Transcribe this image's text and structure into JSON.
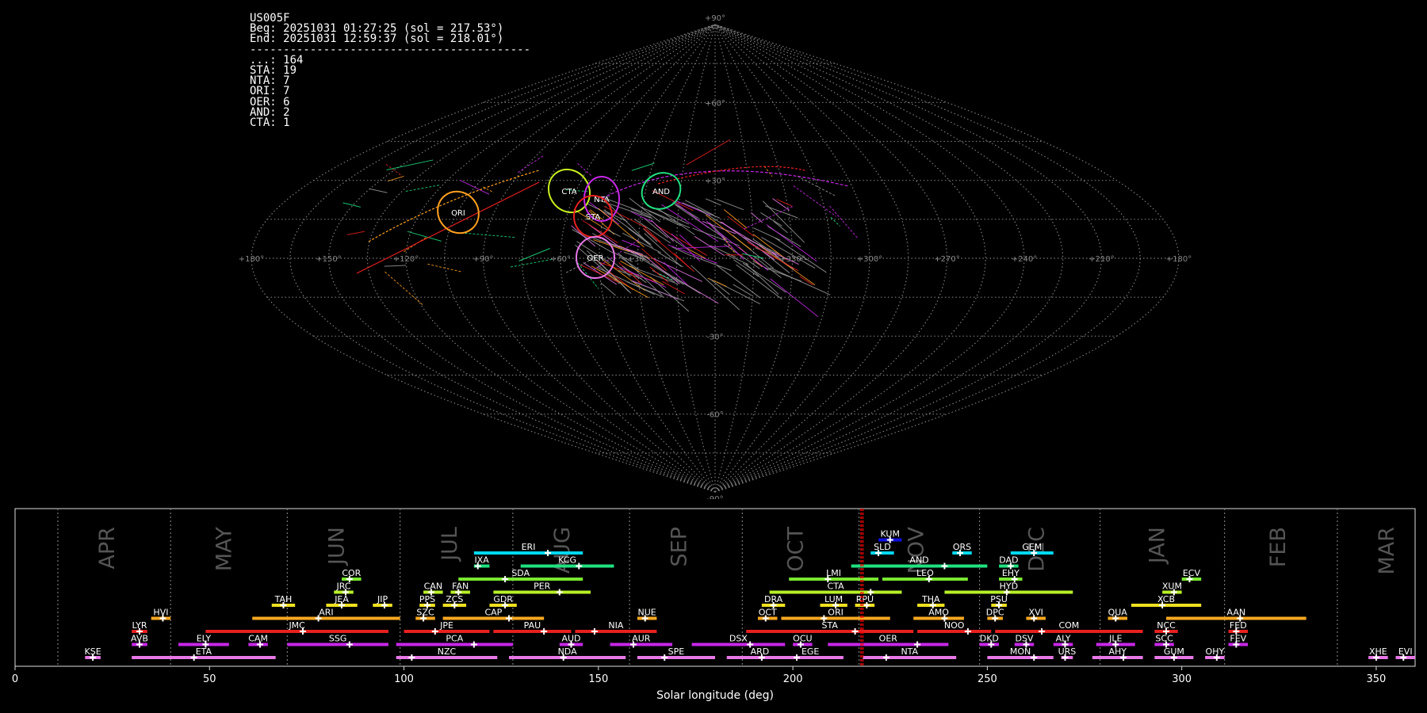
{
  "info": {
    "lines": [
      "US005F",
      "Beg: 20251031 01:27:25 (sol = 217.53°)",
      "End: 20251031 12:59:37 (sol = 218.01°)",
      "------------------------------------------",
      "...: 164",
      "STA: 19",
      "NTA: 7",
      "ORI: 7",
      "OER: 6",
      "AND: 2",
      "CTA: 1"
    ]
  },
  "sky_map": {
    "projection": "sinusoidal",
    "lat_labels": [
      "+90°",
      "+60°",
      "+30°",
      "-30°",
      "-60°",
      "-90°"
    ],
    "lon_labels": [
      "+180°",
      "+150°",
      "+120°",
      "+90°",
      "+60°",
      "+30°",
      "+330°",
      "+300°",
      "+270°",
      "+240°",
      "+210°",
      "+180°"
    ],
    "radiants": [
      {
        "name": "CTA",
        "color": "#c8f020"
      },
      {
        "name": "NTA",
        "color": "#c828e8"
      },
      {
        "name": "AND",
        "color": "#20e080"
      },
      {
        "name": "ORI",
        "color": "#ffa020"
      },
      {
        "name": "STA",
        "color": "#e82020"
      },
      {
        "name": "OER",
        "color": "#e878e8"
      }
    ]
  },
  "chart_data": {
    "type": "bar",
    "xlabel": "Solar longitude (deg)",
    "xlim": [
      0,
      360
    ],
    "xticks": [
      "0",
      "50",
      "100",
      "150",
      "200",
      "250",
      "300",
      "350"
    ],
    "months": [
      {
        "label": "APR",
        "center": 24
      },
      {
        "label": "MAY",
        "center": 54
      },
      {
        "label": "JUN",
        "center": 83
      },
      {
        "label": "JUL",
        "center": 112
      },
      {
        "label": "AUG",
        "center": 141
      },
      {
        "label": "SEP",
        "center": 171
      },
      {
        "label": "OCT",
        "center": 201
      },
      {
        "label": "NOV",
        "center": 232
      },
      {
        "label": "DEC",
        "center": 263
      },
      {
        "label": "JAN",
        "center": 294
      },
      {
        "label": "FEB",
        "center": 325
      },
      {
        "label": "MAR",
        "center": 353
      }
    ],
    "month_boundaries": [
      11,
      40,
      70,
      99,
      128,
      158,
      187,
      217,
      248,
      279,
      311,
      340
    ],
    "current_sol": [
      217.53,
      218.01
    ],
    "current_color": "#ff0000",
    "showers": [
      {
        "code": "KUM",
        "start": 222,
        "end": 228,
        "peak": 225,
        "row": 9,
        "color": "#1010e0"
      },
      {
        "code": "ERI",
        "start": 118,
        "end": 146,
        "peak": 137,
        "row": 8,
        "color": "#00d8f0"
      },
      {
        "code": "SLD",
        "start": 220,
        "end": 226,
        "peak": 222,
        "row": 8,
        "color": "#00d8f0"
      },
      {
        "code": "ORS",
        "start": 241,
        "end": 246,
        "peak": 243,
        "row": 8,
        "color": "#00d8f0"
      },
      {
        "code": "GEM",
        "start": 256,
        "end": 267,
        "peak": 262,
        "row": 8,
        "color": "#00d8f0"
      },
      {
        "code": "IXA",
        "start": 118,
        "end": 122,
        "peak": 119,
        "row": 7,
        "color": "#20e080"
      },
      {
        "code": "KCG",
        "start": 130,
        "end": 154,
        "peak": 145,
        "row": 7,
        "color": "#20e080"
      },
      {
        "code": "AND",
        "start": 215,
        "end": 250,
        "peak": 239,
        "row": 7,
        "color": "#20e080"
      },
      {
        "code": "DAD",
        "start": 253,
        "end": 258,
        "peak": 256,
        "row": 7,
        "color": "#20e080"
      },
      {
        "code": "COR",
        "start": 84,
        "end": 89,
        "peak": 86,
        "row": 6,
        "color": "#78e830"
      },
      {
        "code": "SDA",
        "start": 114,
        "end": 146,
        "peak": 126,
        "row": 6,
        "color": "#78e830"
      },
      {
        "code": "LMI",
        "start": 199,
        "end": 222,
        "peak": 209,
        "row": 6,
        "color": "#78e830"
      },
      {
        "code": "LEO",
        "start": 223,
        "end": 245,
        "peak": 235,
        "row": 6,
        "color": "#78e830"
      },
      {
        "code": "EHY",
        "start": 253,
        "end": 259,
        "peak": 257,
        "row": 6,
        "color": "#78e830"
      },
      {
        "code": "ECV",
        "start": 300,
        "end": 305,
        "peak": 302,
        "row": 6,
        "color": "#78e830"
      },
      {
        "code": "JRC",
        "start": 82,
        "end": 87,
        "peak": 85,
        "row": 5,
        "color": "#b8f028"
      },
      {
        "code": "CAN",
        "start": 105,
        "end": 110,
        "peak": 107,
        "row": 5,
        "color": "#b8f028"
      },
      {
        "code": "FAN",
        "start": 112,
        "end": 117,
        "peak": 114,
        "row": 5,
        "color": "#b8f028"
      },
      {
        "code": "PER",
        "start": 123,
        "end": 148,
        "peak": 140,
        "row": 5,
        "color": "#b8f028"
      },
      {
        "code": "CTA",
        "start": 194,
        "end": 228,
        "peak": 220,
        "row": 5,
        "color": "#b8f028"
      },
      {
        "code": "HYD",
        "start": 239,
        "end": 272,
        "peak": 255,
        "row": 5,
        "color": "#b8f028"
      },
      {
        "code": "XUM",
        "start": 295,
        "end": 300,
        "peak": 298,
        "row": 5,
        "color": "#b8f028"
      },
      {
        "code": "TAH",
        "start": 66,
        "end": 72,
        "peak": 69,
        "row": 4,
        "color": "#f0e020"
      },
      {
        "code": "JEA",
        "start": 80,
        "end": 88,
        "peak": 84,
        "row": 4,
        "color": "#f0e020"
      },
      {
        "code": "JIP",
        "start": 92,
        "end": 97,
        "peak": 95,
        "row": 4,
        "color": "#f0e020"
      },
      {
        "code": "PPS",
        "start": 104,
        "end": 108,
        "peak": 106,
        "row": 4,
        "color": "#f0e020"
      },
      {
        "code": "ZCS",
        "start": 110,
        "end": 116,
        "peak": 113,
        "row": 4,
        "color": "#f0e020"
      },
      {
        "code": "GDR",
        "start": 122,
        "end": 129,
        "peak": 126,
        "row": 4,
        "color": "#f0e020"
      },
      {
        "code": "DRA",
        "start": 192,
        "end": 198,
        "peak": 195,
        "row": 4,
        "color": "#f0e020"
      },
      {
        "code": "LUM",
        "start": 207,
        "end": 214,
        "peak": 211,
        "row": 4,
        "color": "#f0e020"
      },
      {
        "code": "RPU",
        "start": 216,
        "end": 221,
        "peak": 219,
        "row": 4,
        "color": "#f0e020"
      },
      {
        "code": "THA",
        "start": 232,
        "end": 239,
        "peak": 236,
        "row": 4,
        "color": "#f0e020"
      },
      {
        "code": "PSU",
        "start": 251,
        "end": 255,
        "peak": 253,
        "row": 4,
        "color": "#f0e020"
      },
      {
        "code": "XCB",
        "start": 287,
        "end": 305,
        "peak": 295,
        "row": 4,
        "color": "#f0e020"
      },
      {
        "code": "HVI",
        "start": 35,
        "end": 40,
        "peak": 38,
        "row": 3,
        "color": "#f8a820"
      },
      {
        "code": "ARI",
        "start": 61,
        "end": 99,
        "peak": 78,
        "row": 3,
        "color": "#f8a820"
      },
      {
        "code": "SZC",
        "start": 103,
        "end": 108,
        "peak": 105,
        "row": 3,
        "color": "#f8a820"
      },
      {
        "code": "CAP",
        "start": 110,
        "end": 136,
        "peak": 127,
        "row": 3,
        "color": "#f8a820"
      },
      {
        "code": "NUE",
        "start": 160,
        "end": 165,
        "peak": 162,
        "row": 3,
        "color": "#f8a820"
      },
      {
        "code": "OCT",
        "start": 191,
        "end": 196,
        "peak": 193,
        "row": 3,
        "color": "#f8a820"
      },
      {
        "code": "ORI",
        "start": 197,
        "end": 225,
        "peak": 208,
        "row": 3,
        "color": "#f8a820"
      },
      {
        "code": "AMO",
        "start": 231,
        "end": 244,
        "peak": 239,
        "row": 3,
        "color": "#f8a820"
      },
      {
        "code": "DPC",
        "start": 250,
        "end": 254,
        "peak": 252,
        "row": 3,
        "color": "#f8a820"
      },
      {
        "code": "XVI",
        "start": 260,
        "end": 265,
        "peak": 262,
        "row": 3,
        "color": "#f8a820"
      },
      {
        "code": "QUA",
        "start": 281,
        "end": 286,
        "peak": 283,
        "row": 3,
        "color": "#f8a820"
      },
      {
        "code": "AAN",
        "start": 296,
        "end": 332,
        "peak": 315,
        "row": 3,
        "color": "#f8a820"
      },
      {
        "code": "LYR",
        "start": 30,
        "end": 34,
        "peak": 32,
        "row": 2,
        "color": "#e82020"
      },
      {
        "code": "JMC",
        "start": 49,
        "end": 96,
        "peak": 74,
        "row": 2,
        "color": "#e82020"
      },
      {
        "code": "JPE",
        "start": 100,
        "end": 122,
        "peak": 108,
        "row": 2,
        "color": "#e82020"
      },
      {
        "code": "PAU",
        "start": 123,
        "end": 143,
        "peak": 136,
        "row": 2,
        "color": "#e82020"
      },
      {
        "code": "NIA",
        "start": 144,
        "end": 165,
        "peak": 149,
        "row": 2,
        "color": "#e82020"
      },
      {
        "code": "STA",
        "start": 188,
        "end": 231,
        "peak": 216,
        "row": 2,
        "color": "#e82020"
      },
      {
        "code": "NOO",
        "start": 232,
        "end": 251,
        "peak": 245,
        "row": 2,
        "color": "#e82020"
      },
      {
        "code": "COM",
        "start": 252,
        "end": 290,
        "peak": 264,
        "row": 2,
        "color": "#e82020"
      },
      {
        "code": "NCC",
        "start": 293,
        "end": 299,
        "peak": 296,
        "row": 2,
        "color": "#e82020"
      },
      {
        "code": "FED",
        "start": 312,
        "end": 317,
        "peak": 314,
        "row": 2,
        "color": "#e82020"
      },
      {
        "code": "AVB",
        "start": 30,
        "end": 34,
        "peak": 32,
        "row": 1,
        "color": "#c828e8"
      },
      {
        "code": "ELY",
        "start": 42,
        "end": 55,
        "peak": 49,
        "row": 1,
        "color": "#c828e8"
      },
      {
        "code": "CAM",
        "start": 60,
        "end": 65,
        "peak": 63,
        "row": 1,
        "color": "#c828e8"
      },
      {
        "code": "SSG",
        "start": 70,
        "end": 96,
        "peak": 86,
        "row": 1,
        "color": "#c828e8"
      },
      {
        "code": "PCA",
        "start": 98,
        "end": 128,
        "peak": 118,
        "row": 1,
        "color": "#c828e8"
      },
      {
        "code": "AUD",
        "start": 140,
        "end": 146,
        "peak": 143,
        "row": 1,
        "color": "#c828e8"
      },
      {
        "code": "AUR",
        "start": 153,
        "end": 169,
        "peak": 159,
        "row": 1,
        "color": "#c828e8"
      },
      {
        "code": "DSX",
        "start": 174,
        "end": 198,
        "peak": 189,
        "row": 1,
        "color": "#c828e8"
      },
      {
        "code": "OCU",
        "start": 200,
        "end": 205,
        "peak": 202,
        "row": 1,
        "color": "#c828e8"
      },
      {
        "code": "OER",
        "start": 209,
        "end": 240,
        "peak": 232,
        "row": 1,
        "color": "#c828e8"
      },
      {
        "code": "DKD",
        "start": 248,
        "end": 253,
        "peak": 251,
        "row": 1,
        "color": "#c828e8"
      },
      {
        "code": "DSV",
        "start": 257,
        "end": 262,
        "peak": 260,
        "row": 1,
        "color": "#c828e8"
      },
      {
        "code": "ALY",
        "start": 267,
        "end": 272,
        "peak": 270,
        "row": 1,
        "color": "#c828e8"
      },
      {
        "code": "JLE",
        "start": 278,
        "end": 288,
        "peak": 283,
        "row": 1,
        "color": "#c828e8"
      },
      {
        "code": "SCC",
        "start": 293,
        "end": 298,
        "peak": 296,
        "row": 1,
        "color": "#c828e8"
      },
      {
        "code": "FEV",
        "start": 312,
        "end": 317,
        "peak": 314,
        "row": 1,
        "color": "#c828e8"
      },
      {
        "code": "KSE",
        "start": 18,
        "end": 22,
        "peak": 20,
        "row": 0,
        "color": "#e878e8"
      },
      {
        "code": "ETA",
        "start": 30,
        "end": 67,
        "peak": 46,
        "row": 0,
        "color": "#e878e8"
      },
      {
        "code": "NZC",
        "start": 98,
        "end": 124,
        "peak": 102,
        "row": 0,
        "color": "#e878e8"
      },
      {
        "code": "NDA",
        "start": 127,
        "end": 157,
        "peak": 141,
        "row": 0,
        "color": "#e878e8"
      },
      {
        "code": "SPE",
        "start": 160,
        "end": 180,
        "peak": 167,
        "row": 0,
        "color": "#e878e8"
      },
      {
        "code": "ARD",
        "start": 183,
        "end": 200,
        "peak": 192,
        "row": 0,
        "color": "#e878e8"
      },
      {
        "code": "EGE",
        "start": 196,
        "end": 213,
        "peak": 201,
        "row": 0,
        "color": "#e878e8"
      },
      {
        "code": "NTA",
        "start": 218,
        "end": 242,
        "peak": 224,
        "row": 0,
        "color": "#e878e8"
      },
      {
        "code": "MON",
        "start": 250,
        "end": 267,
        "peak": 262,
        "row": 0,
        "color": "#e878e8"
      },
      {
        "code": "URS",
        "start": 269,
        "end": 272,
        "peak": 270,
        "row": 0,
        "color": "#e878e8"
      },
      {
        "code": "AHY",
        "start": 277,
        "end": 290,
        "peak": 285,
        "row": 0,
        "color": "#e878e8"
      },
      {
        "code": "GUM",
        "start": 293,
        "end": 303,
        "peak": 298,
        "row": 0,
        "color": "#e878e8"
      },
      {
        "code": "OHY",
        "start": 306,
        "end": 311,
        "peak": 309,
        "row": 0,
        "color": "#e878e8"
      },
      {
        "code": "XHE",
        "start": 348,
        "end": 353,
        "peak": 350,
        "row": 0,
        "color": "#e878e8"
      },
      {
        "code": "EVI",
        "start": 355,
        "end": 360,
        "peak": 357,
        "row": 0,
        "color": "#e878e8"
      }
    ]
  }
}
